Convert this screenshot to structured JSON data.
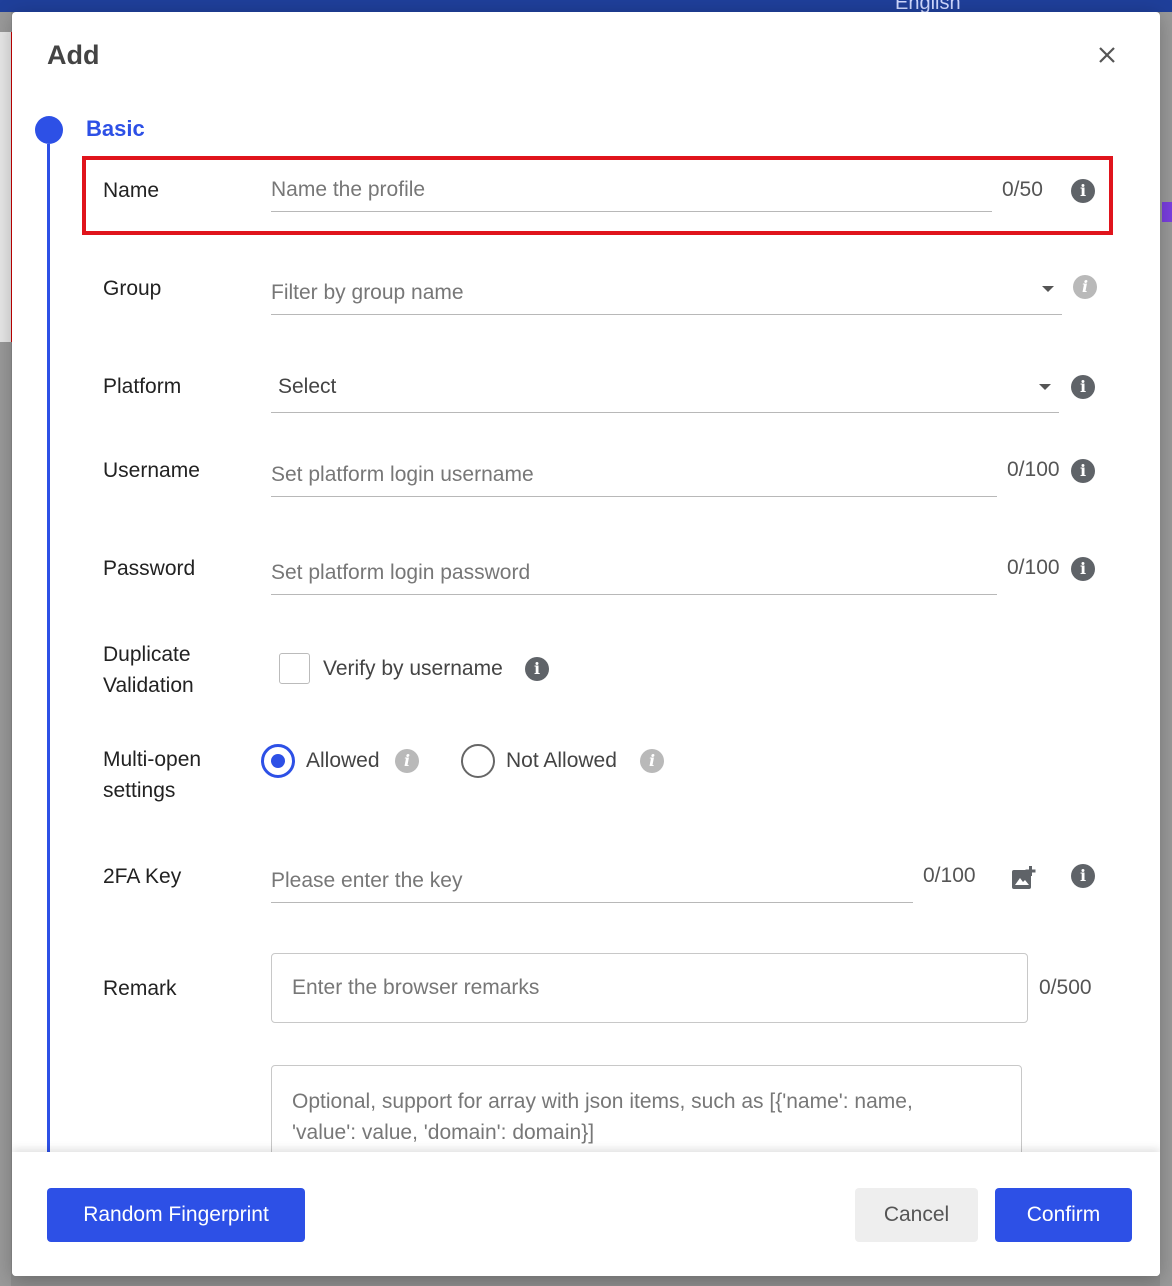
{
  "background": {
    "language_label": "English"
  },
  "dialog": {
    "title": "Add",
    "step_title": "Basic"
  },
  "form": {
    "name": {
      "label": "Name",
      "placeholder": "Name the profile",
      "counter": "0/50"
    },
    "group": {
      "label": "Group",
      "placeholder": "Filter by group name"
    },
    "platform": {
      "label": "Platform",
      "value": "Select"
    },
    "username": {
      "label": "Username",
      "placeholder": "Set platform login username",
      "counter": "0/100"
    },
    "password": {
      "label": "Password",
      "placeholder": "Set platform login password",
      "counter": "0/100"
    },
    "duplicate_validation": {
      "label_line1": "Duplicate",
      "label_line2": "Validation",
      "option": "Verify by username",
      "checked": false
    },
    "multi_open": {
      "label_line1": "Multi-open",
      "label_line2": "settings",
      "options": [
        "Allowed",
        "Not Allowed"
      ],
      "selected": "Allowed"
    },
    "twofa": {
      "label": "2FA Key",
      "placeholder": "Please enter the key",
      "counter": "0/100"
    },
    "remark": {
      "label": "Remark",
      "placeholder": "Enter the browser remarks",
      "counter": "0/500"
    },
    "cookie": {
      "placeholder_line1": "Optional, support for array with json items, such as [{'name': name,",
      "placeholder_line2": "'value': value, 'domain': domain}]"
    }
  },
  "footer": {
    "random_label": "Random Fingerprint",
    "cancel_label": "Cancel",
    "confirm_label": "Confirm"
  },
  "colors": {
    "primary": "#2d50e6",
    "highlight_border": "#e0141c"
  },
  "icons": [
    "close-icon",
    "info-icon",
    "chevron-down-icon",
    "add-image-icon"
  ]
}
